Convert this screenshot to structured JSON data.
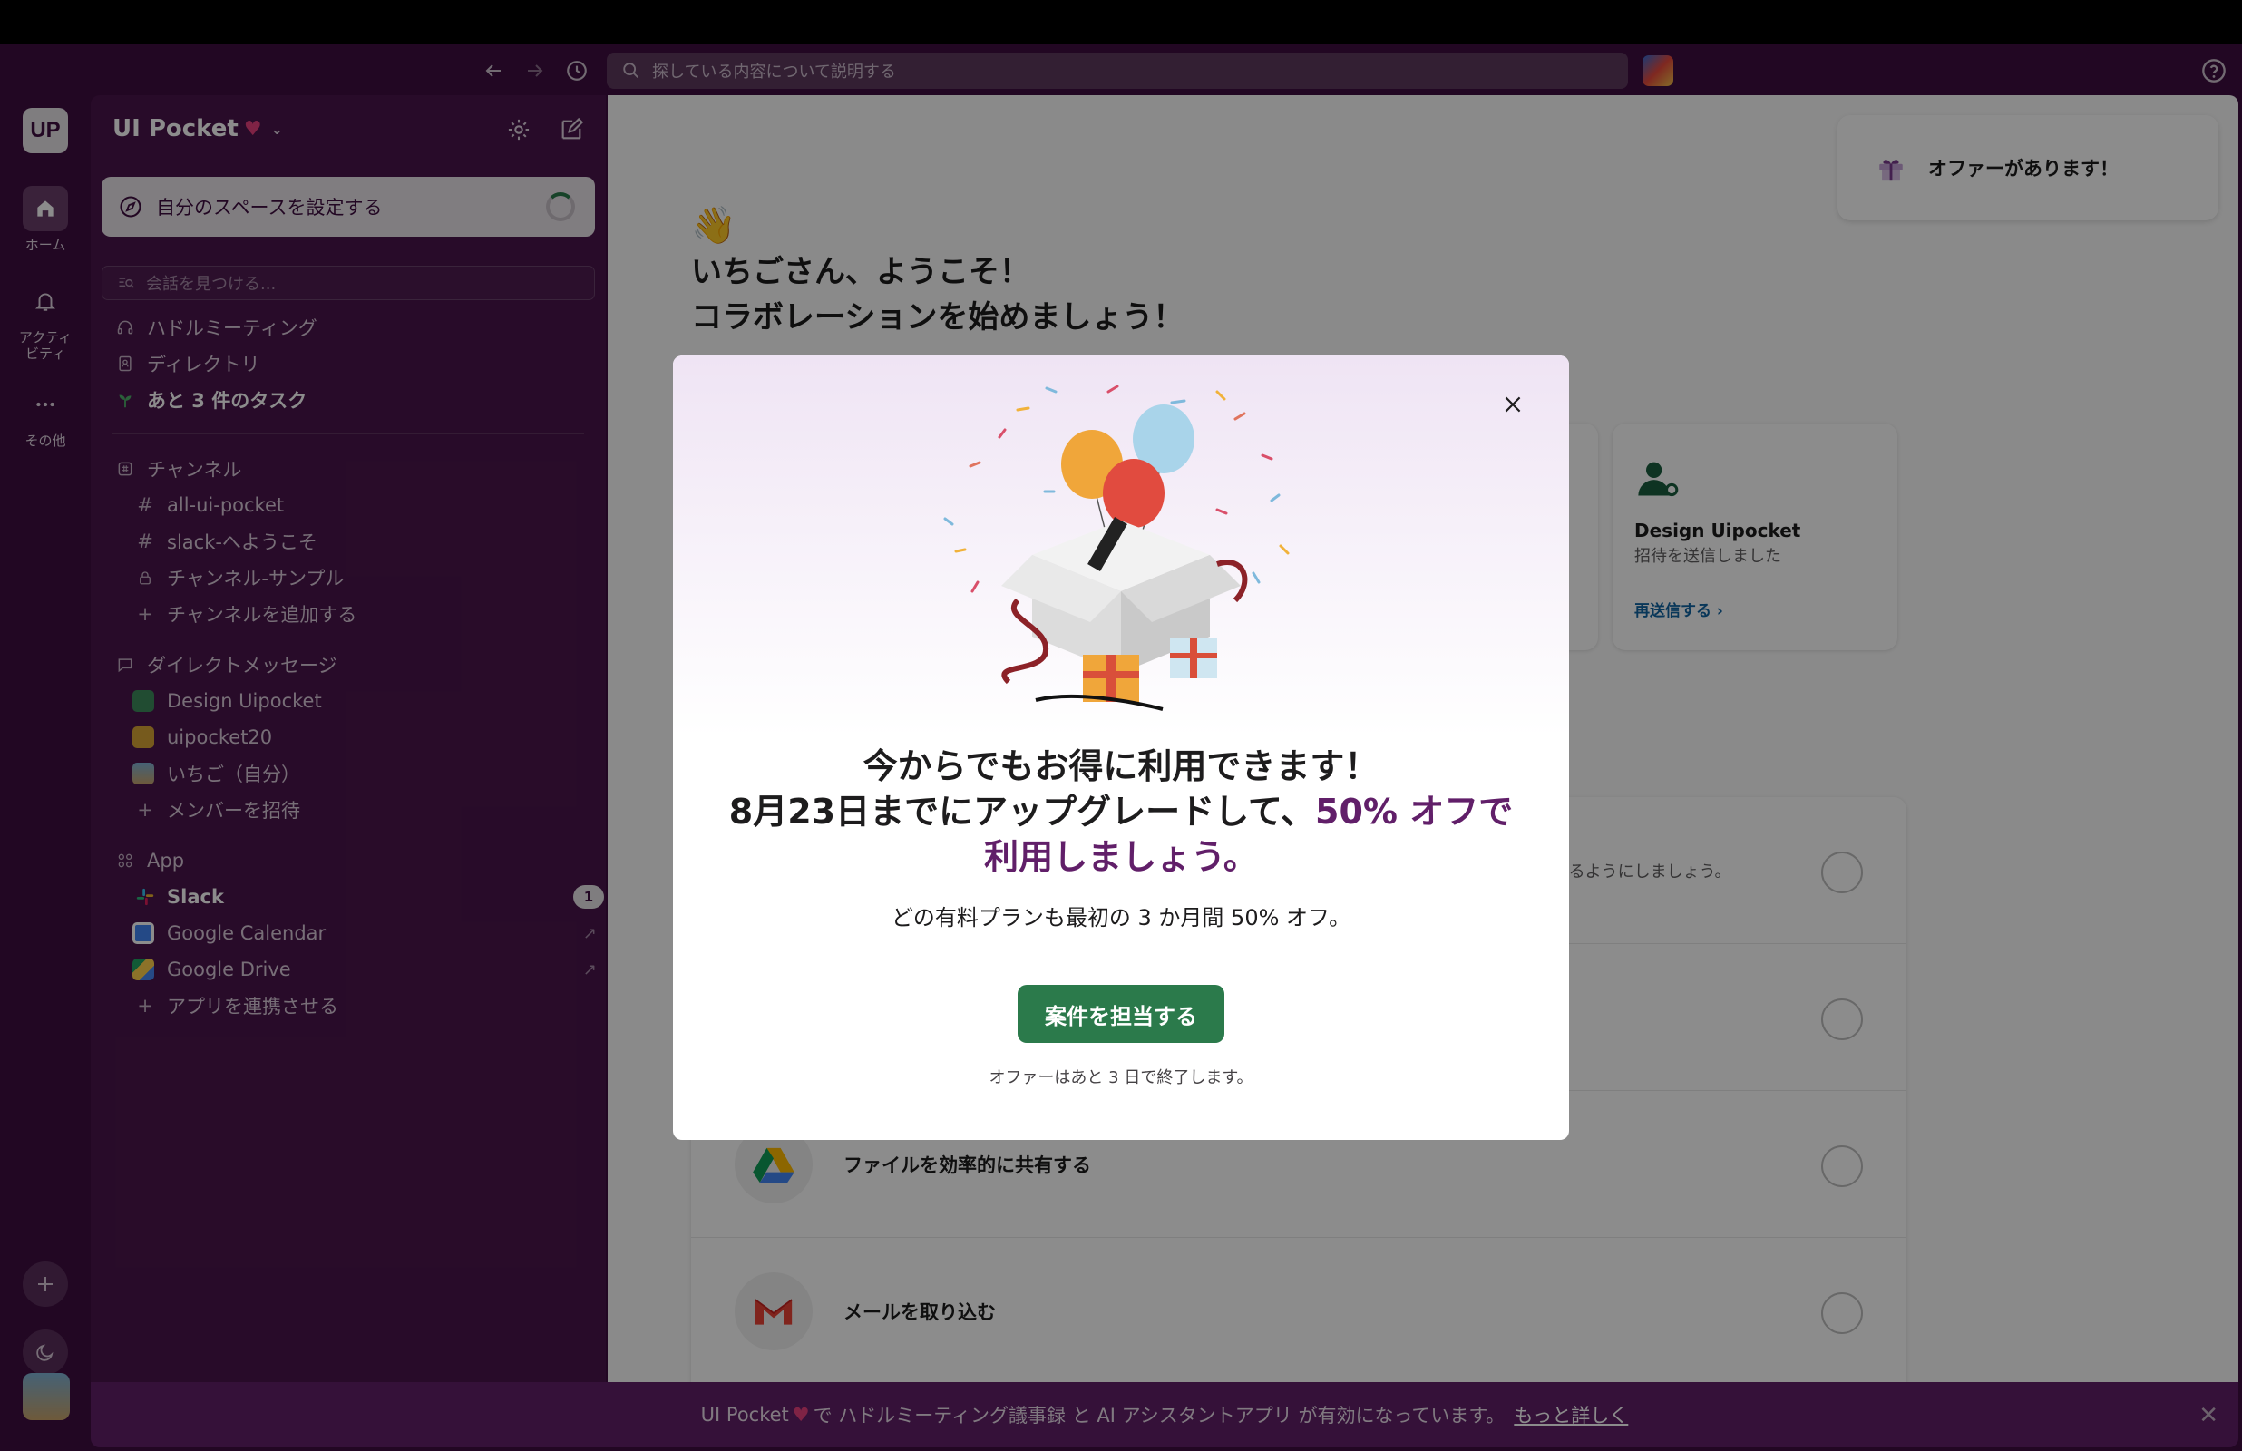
{
  "toolbar": {
    "search_placeholder": "探している内容について説明する"
  },
  "rail": {
    "workspace_initials": "UP",
    "items": [
      {
        "label": "ホーム"
      },
      {
        "label": "アクティビティ"
      },
      {
        "label": "その他"
      }
    ]
  },
  "sidebar": {
    "workspace_name": "UI Pocket",
    "setup_label": "自分のスペースを設定する",
    "search_placeholder": "会話を見つける...",
    "quick": [
      {
        "label": "ハドルミーティング"
      },
      {
        "label": "ディレクトリ"
      },
      {
        "label": "あと 3 件のタスク"
      }
    ],
    "channels_header": "チャンネル",
    "channels": [
      {
        "label": "all-ui-pocket"
      },
      {
        "label": "slack-へようこそ"
      },
      {
        "label": "チャンネル-サンプル"
      },
      {
        "label": "チャンネルを追加する"
      }
    ],
    "dm_header": "ダイレクトメッセージ",
    "dms": [
      {
        "label": "Design Uipocket"
      },
      {
        "label": "uipocket20"
      },
      {
        "label": "いちご（自分）"
      },
      {
        "label": "メンバーを招待"
      }
    ],
    "apps_header": "App",
    "apps": [
      {
        "label": "Slack",
        "badge": "1"
      },
      {
        "label": "Google Calendar"
      },
      {
        "label": "Google Drive"
      },
      {
        "label": "アプリを連携させる"
      }
    ]
  },
  "main": {
    "wave": "👋",
    "welcome_line1": "いちごさん、ようこそ！",
    "welcome_line2": "コラボレーションを始めましょう！",
    "offer_card": "オファーがあります！",
    "invite": {
      "name": "Design Uipocket",
      "status": "招待を送信しました",
      "resend": "再送信する ›"
    },
    "tasks": [
      {
        "label": "",
        "sub": "きるようにしましょう。"
      },
      {
        "label": ""
      },
      {
        "label": "ファイルを効率的に共有する"
      },
      {
        "label": "メールを取り込む"
      }
    ]
  },
  "banner": {
    "text_a": "UI Pocket",
    "text_b": "で ハドルミーティング議事録 と AI アシスタントアプリ が有効になっています。",
    "link": "もっと詳しく"
  },
  "modal": {
    "headline1": "今からでもお得に利用できます！",
    "headline2a": "8月23日までにアップグレードして、",
    "headline2b": "50% オフで",
    "headline3": "利用しましょう。",
    "description": "どの有料プランも最初の 3 か月間 50% オフ。",
    "cta": "案件を担当する",
    "note": "オファーはあと 3 日で終了します。"
  },
  "colors": {
    "aubergine": "#3f0e40",
    "sidebar": "#4a154b",
    "cta_green": "#2b7a4b",
    "highlight": "#611f69"
  }
}
